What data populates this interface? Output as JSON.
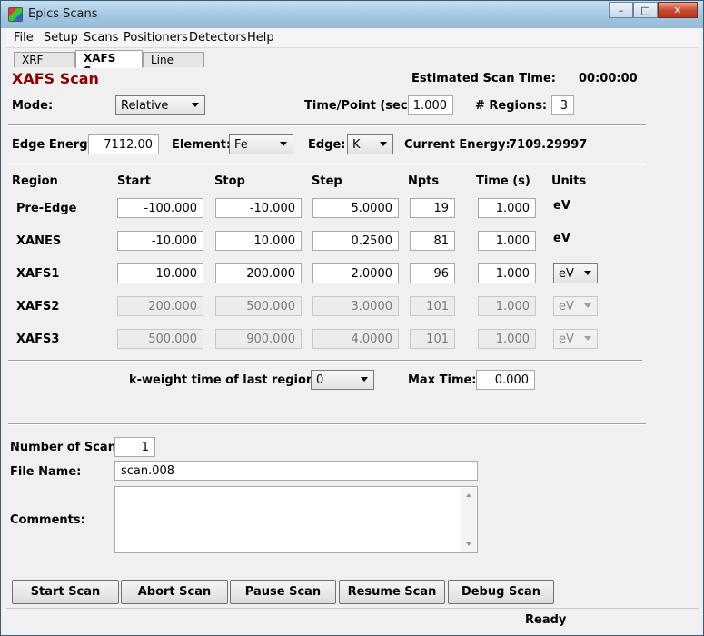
{
  "window": {
    "title": "Epics Scans"
  },
  "menu": [
    "File",
    "Setup",
    "Scans",
    "Positioners",
    "Detectors",
    "Help"
  ],
  "tabs": [
    "XRF Maps",
    "XAFS Scans",
    "Line Scans"
  ],
  "header": {
    "title": "XAFS Scan",
    "title_color": "#8b0000",
    "est_time_label": "Estimated Scan Time:",
    "est_time_value": "00:00:00"
  },
  "mode": {
    "label": "Mode:",
    "value": "Relative"
  },
  "time_point": {
    "label": "Time/Point (sec):",
    "value": "1.000"
  },
  "regions_count": {
    "label": "# Regions:",
    "value": "3"
  },
  "edge": {
    "energy_label": "Edge Energy:",
    "energy_value": "7112.00",
    "element_label": "Element:",
    "element_value": "Fe",
    "edge_label": "Edge:",
    "edge_value": "K",
    "current_label": "Current Energy:",
    "current_value": "7109.29997"
  },
  "table": {
    "headers": [
      "Region",
      "Start",
      "Stop",
      "Step",
      "Npts",
      "Time (s)",
      "Units"
    ],
    "rows": [
      {
        "name": "Pre-Edge",
        "start": "-100.000",
        "stop": "-10.000",
        "step": "5.0000",
        "npts": "19",
        "time": "1.000",
        "units": "eV"
      },
      {
        "name": "XANES",
        "start": "-10.000",
        "stop": "10.000",
        "step": "0.2500",
        "npts": "81",
        "time": "1.000",
        "units": "eV"
      },
      {
        "name": "XAFS1",
        "start": "10.000",
        "stop": "200.000",
        "step": "2.0000",
        "npts": "96",
        "time": "1.000",
        "units": "eV"
      },
      {
        "name": "XAFS2",
        "start": "200.000",
        "stop": "500.000",
        "step": "3.0000",
        "npts": "101",
        "time": "1.000",
        "units": "eV"
      },
      {
        "name": "XAFS3",
        "start": "500.000",
        "stop": "900.000",
        "step": "4.0000",
        "npts": "101",
        "time": "1.000",
        "units": "eV"
      }
    ]
  },
  "kweight": {
    "label": "k-weight time of last region:",
    "value": "0",
    "max_label": "Max Time:",
    "max_value": "0.000"
  },
  "scans": {
    "label": "Number of Scans:",
    "value": "1"
  },
  "file": {
    "label": "File Name:",
    "value": "scan.008"
  },
  "comments": {
    "label": "Comments:",
    "value": ""
  },
  "buttons": {
    "start": "Start Scan",
    "abort": "Abort Scan",
    "pause": "Pause Scan",
    "resume": "Resume Scan",
    "debug": "Debug Scan"
  },
  "status": {
    "text": "Ready"
  }
}
